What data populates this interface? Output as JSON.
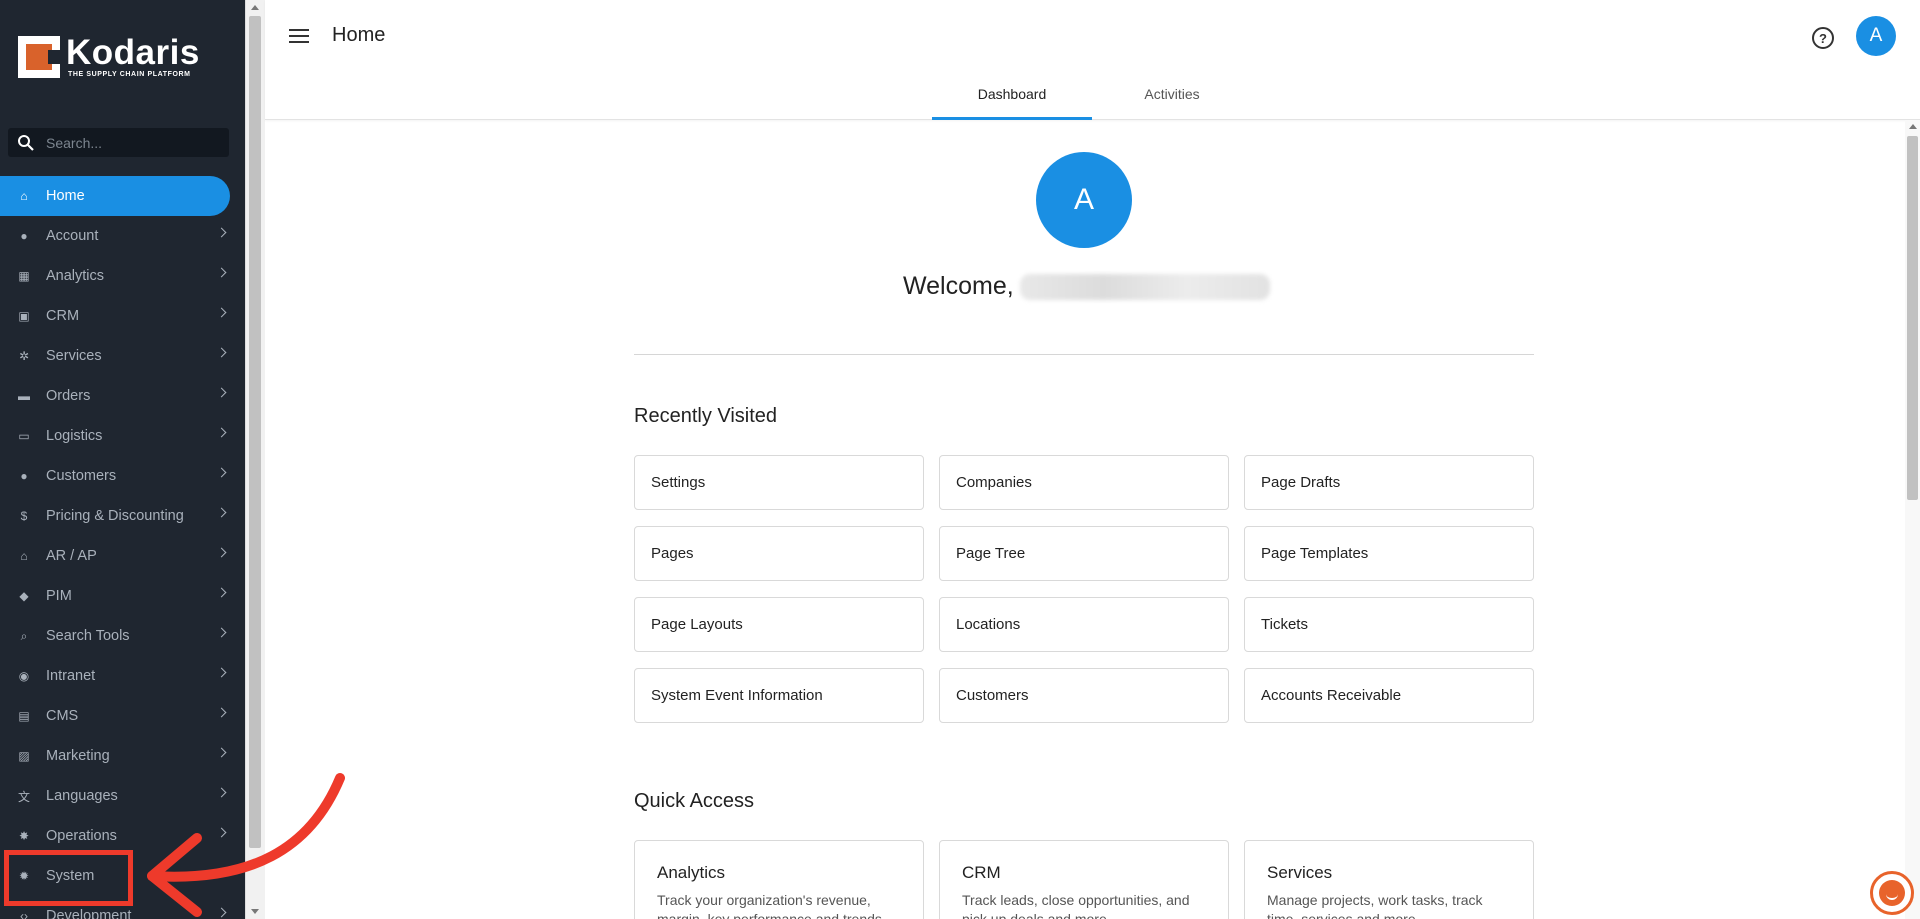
{
  "brand": {
    "name": "Kodaris",
    "tagline": "THE SUPPLY CHAIN PLATFORM",
    "accent": "#1a8fe3",
    "logo_color": "#d9622b"
  },
  "search": {
    "placeholder": "Search..."
  },
  "sidebar": {
    "items": [
      {
        "label": "Home",
        "icon": "home-icon",
        "glyph": "⌂",
        "active": true,
        "chevron": false
      },
      {
        "label": "Account",
        "icon": "person-icon",
        "glyph": "●",
        "chevron": true
      },
      {
        "label": "Analytics",
        "icon": "chart-icon",
        "glyph": "▦",
        "chevron": true
      },
      {
        "label": "CRM",
        "icon": "contact-card-icon",
        "glyph": "▣",
        "chevron": true
      },
      {
        "label": "Services",
        "icon": "gears-icon",
        "glyph": "✲",
        "chevron": true
      },
      {
        "label": "Orders",
        "icon": "truck-icon",
        "glyph": "▬",
        "chevron": true
      },
      {
        "label": "Logistics",
        "icon": "shipping-icon",
        "glyph": "▭",
        "chevron": true
      },
      {
        "label": "Customers",
        "icon": "people-icon",
        "glyph": "●",
        "chevron": true
      },
      {
        "label": "Pricing & Discounting",
        "icon": "dollar-icon",
        "glyph": "$",
        "chevron": true
      },
      {
        "label": "AR / AP",
        "icon": "bank-icon",
        "glyph": "⌂",
        "chevron": true
      },
      {
        "label": "PIM",
        "icon": "tag-icon",
        "glyph": "◆",
        "chevron": true
      },
      {
        "label": "Search Tools",
        "icon": "search-icon",
        "glyph": "⌕",
        "chevron": true
      },
      {
        "label": "Intranet",
        "icon": "intranet-icon",
        "glyph": "◉",
        "chevron": true
      },
      {
        "label": "CMS",
        "icon": "cms-icon",
        "glyph": "▤",
        "chevron": true
      },
      {
        "label": "Marketing",
        "icon": "campaign-icon",
        "glyph": "▨",
        "chevron": true
      },
      {
        "label": "Languages",
        "icon": "translate-icon",
        "glyph": "文",
        "chevron": true
      },
      {
        "label": "Operations",
        "icon": "operations-icon",
        "glyph": "✸",
        "chevron": true
      },
      {
        "label": "System",
        "icon": "gear-icon",
        "glyph": "✹",
        "chevron": false
      },
      {
        "label": "Development",
        "icon": "code-icon",
        "glyph": "‹›",
        "chevron": true
      }
    ]
  },
  "header": {
    "title": "Home",
    "avatar_initial": "A",
    "tabs": [
      {
        "label": "Dashboard",
        "active": true
      },
      {
        "label": "Activities",
        "active": false
      }
    ]
  },
  "main": {
    "avatar_initial": "A",
    "welcome": "Welcome,",
    "recent_title": "Recently Visited",
    "recent": [
      "Settings",
      "Companies",
      "Page Drafts",
      "Pages",
      "Page Tree",
      "Page Templates",
      "Page Layouts",
      "Locations",
      "Tickets",
      "System Event Information",
      "Customers",
      "Accounts Receivable"
    ],
    "quick_title": "Quick Access",
    "quick": [
      {
        "title": "Analytics",
        "desc": "Track your organization's revenue, margin, key performance and trends"
      },
      {
        "title": "CRM",
        "desc": "Track leads, close opportunities, and pick up deals and more"
      },
      {
        "title": "Services",
        "desc": "Manage projects, work tasks, track time, services and more"
      }
    ]
  },
  "annotation": {
    "color": "#ee3a2b"
  }
}
